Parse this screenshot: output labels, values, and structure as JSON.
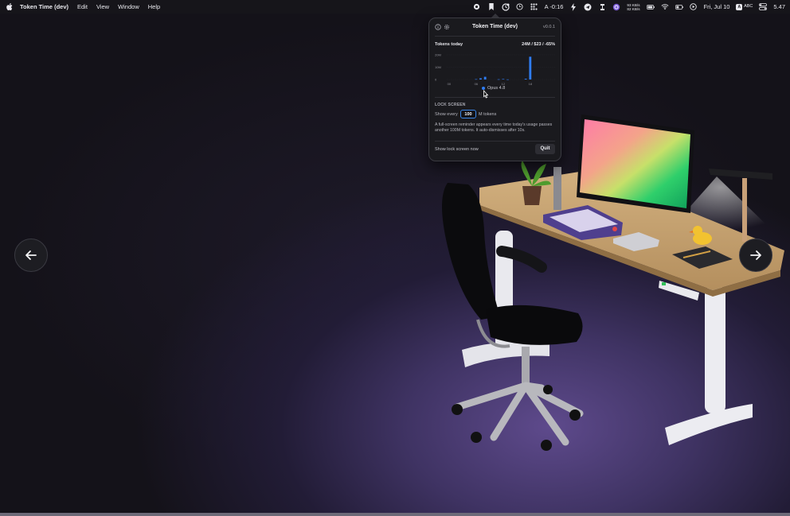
{
  "menubar": {
    "app_name": "Token Time (dev)",
    "menus": [
      "Edit",
      "View",
      "Window",
      "Help"
    ],
    "status_timer": "A -0:16",
    "net_up": "93 KB/s",
    "net_down": "82 KB/s",
    "date": "Fri, Jul 10",
    "input_source": "ABC",
    "battery_value": "5.47",
    "icons": [
      "apple-icon",
      "record-icon",
      "bookmark-icon",
      "token-time-icon",
      "clock-icon",
      "grid-icon",
      "bolt-icon",
      "send-icon",
      "sync-icon",
      "circle-app-icon",
      "wifi-icon",
      "battery-icon",
      "play-icon",
      "input-source-icon",
      "control-center-icon"
    ]
  },
  "popover": {
    "title": "Token Time (dev)",
    "version": "v0.0.1",
    "tokens_label": "Tokens today",
    "tokens_summary": "24M / $23 / -65%",
    "legend_label": "Opus 4.8",
    "lock_section_label": "LOCK SCREEN",
    "show_every_label": "Show every",
    "threshold_value": "100",
    "threshold_unit": "M tokens",
    "description": "A full-screen reminder appears every time today's usage passes another 100M tokens. It auto-dismisses after 10s.",
    "show_lock_now": "Show lock screen now",
    "quit_label": "Quit"
  },
  "chart_data": {
    "type": "bar",
    "y_ticks": [
      "20M",
      "10M",
      "0"
    ],
    "x_ticks": [
      "00",
      "06",
      "12",
      "18"
    ],
    "ylim": [
      0,
      20
    ],
    "series": [
      {
        "name": "Opus 4.8",
        "color": "#2f7df6",
        "x": [
          0,
          1,
          2,
          3,
          4,
          5,
          6,
          7,
          8,
          9,
          10,
          11,
          12,
          13,
          14,
          15,
          16,
          17,
          18,
          19,
          20,
          21,
          22,
          23
        ],
        "values": [
          0,
          0,
          0,
          0,
          0,
          0,
          0.3,
          1.0,
          2.2,
          0,
          0,
          0.2,
          0.4,
          0.1,
          0,
          0,
          0,
          0.6,
          18.5,
          0,
          0,
          0,
          0,
          0
        ]
      }
    ]
  },
  "navigation": {
    "prev_icon": "arrow-left-icon",
    "next_icon": "arrow-right-icon"
  }
}
